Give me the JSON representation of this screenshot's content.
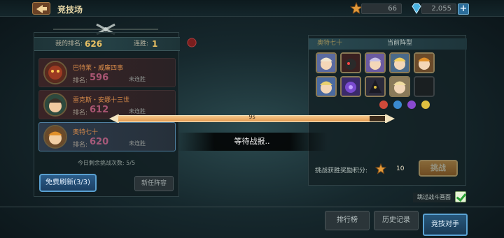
{
  "header": {
    "title": "竞技场",
    "stamina": "66",
    "diamonds": "2,055",
    "plus": "+"
  },
  "rank": {
    "my_rank_label": "我的排名:",
    "my_rank_value": "626",
    "streak_label": "连胜:",
    "streak_value": "1"
  },
  "opponents": [
    {
      "name": "巴特莱・威廉四事",
      "rank_label": "排名:",
      "rank_value": "596",
      "status": "未连胜"
    },
    {
      "name": "雷克斯・安娜十三世",
      "rank_label": "排名:",
      "rank_value": "612",
      "status": "未连胜"
    },
    {
      "name": "奥特七十",
      "rank_label": "排名:",
      "rank_value": "620",
      "status": "未连胜"
    }
  ],
  "remaining": "今日剩余挑战次数: 5/5",
  "buttons": {
    "free_refresh": "免费刷新(3/3)",
    "new_lineup": "新任阵容",
    "challenge": "挑战"
  },
  "lineup": {
    "opponent_name": "奥特七十",
    "title": "当前阵型"
  },
  "reward": {
    "label": "挑战获胜奖励积分:",
    "value": "10"
  },
  "skip_battle": "跳过战斗画面",
  "tabs": {
    "ranking": "排行榜",
    "history": "历史记录",
    "arena": "竞技对手"
  },
  "overlay": {
    "progress_text": "9s",
    "progress_fraction": 0.94,
    "waiting_text": "等待战报.."
  },
  "colors": {
    "accent_gold": "#e8c063",
    "rank_pink": "#d0668c",
    "progress_fill": "#e39a50"
  }
}
